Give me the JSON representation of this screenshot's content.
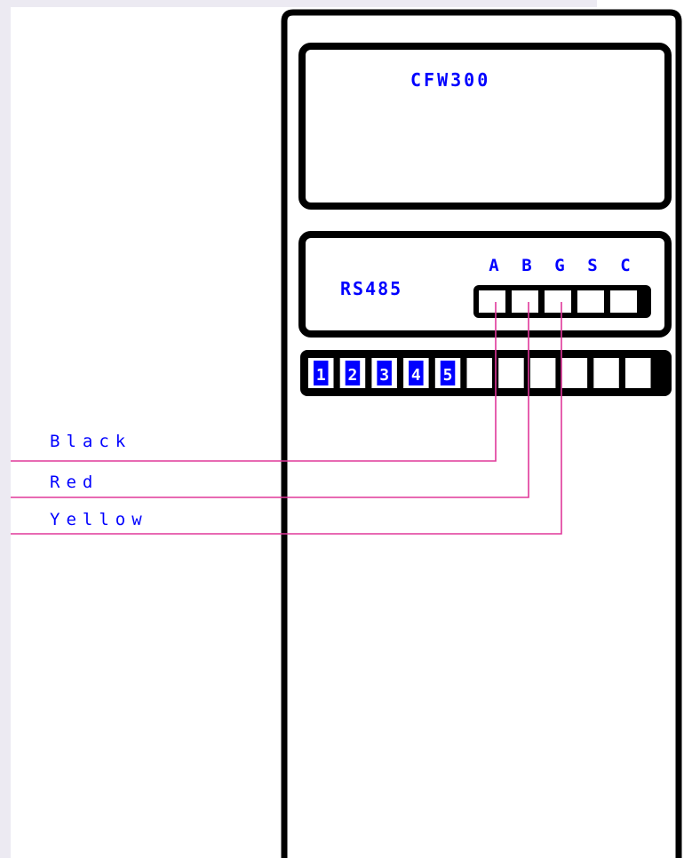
{
  "device": {
    "model": "CFW300",
    "interface_label": "RS485",
    "rs485_terminals": [
      "A",
      "B",
      "G",
      "S",
      "C"
    ],
    "numbered_terminals": [
      "1",
      "2",
      "3",
      "4",
      "5"
    ]
  },
  "wires": [
    {
      "label": "Black",
      "terminal": "A"
    },
    {
      "label": "Red",
      "terminal": "B"
    },
    {
      "label": "Yellow",
      "terminal": "G"
    }
  ],
  "colors": {
    "outline": "#000000",
    "text": "#0000ff",
    "wire": "#e0389a",
    "paper": "#ffffff",
    "background": "#eceaf2"
  }
}
